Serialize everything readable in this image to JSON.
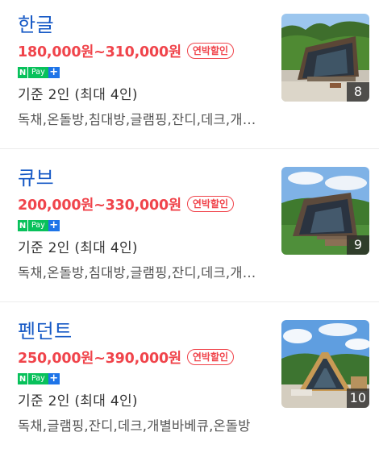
{
  "listings": [
    {
      "name": "한글",
      "price": "180,000원~310,000원",
      "badge": "연박할인",
      "npay": {
        "n": "N",
        "pay": "Pay",
        "plus": "+"
      },
      "capacity": "기준 2인 (최대 4인)",
      "tags": "독채,온돌방,침대방,글램핑,잔디,데크,개별바베큐",
      "photo_count": "8"
    },
    {
      "name": "큐브",
      "price": "200,000원~330,000원",
      "badge": "연박할인",
      "npay": {
        "n": "N",
        "pay": "Pay",
        "plus": "+"
      },
      "capacity": "기준 2인 (최대 4인)",
      "tags": "독채,온돌방,침대방,글램핑,잔디,데크,개별바베큐",
      "photo_count": "9"
    },
    {
      "name": "펜던트",
      "price": "250,000원~390,000원",
      "badge": "연박할인",
      "npay": {
        "n": "N",
        "pay": "Pay",
        "plus": "+"
      },
      "capacity": "기준 2인 (최대 4인)",
      "tags": "독채,글램핑,잔디,데크,개별바베큐,온돌방",
      "photo_count": "10"
    }
  ],
  "colors": {
    "name": "#1558c5",
    "price": "#f0444b",
    "npay_green": "#08c15b",
    "npay_blue": "#1e74e8"
  }
}
